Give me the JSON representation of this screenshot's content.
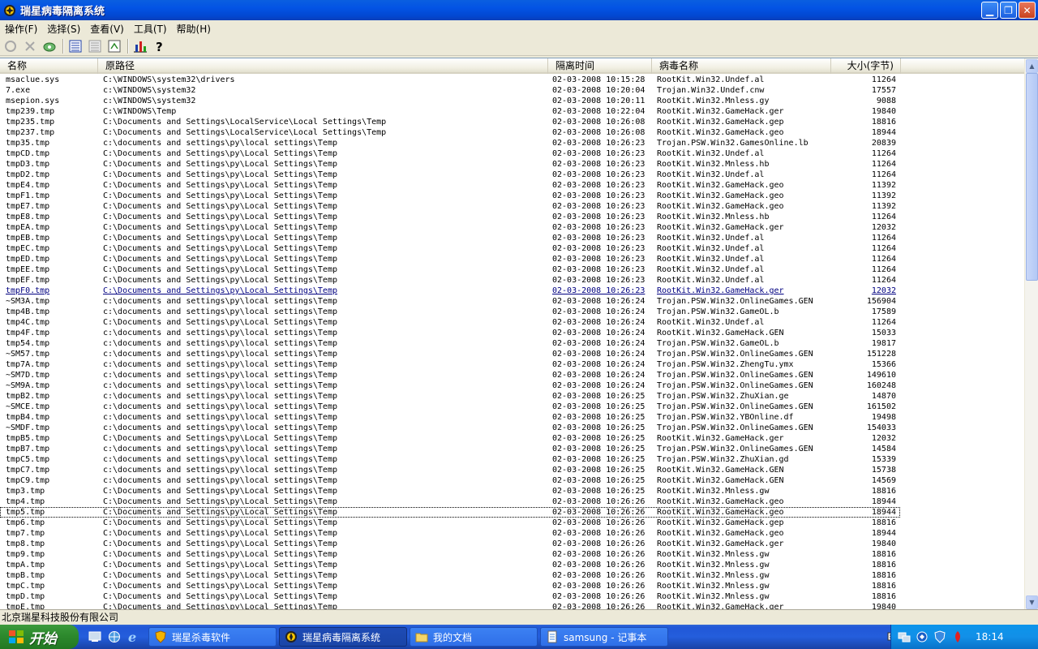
{
  "window": {
    "title": "瑞星病毒隔离系统"
  },
  "menu": [
    {
      "label": "操作(F)"
    },
    {
      "label": "选择(S)"
    },
    {
      "label": "查看(V)"
    },
    {
      "label": "工具(T)"
    },
    {
      "label": "帮助(H)"
    }
  ],
  "toolbar": {
    "icons": [
      "restore-icon",
      "delete-icon",
      "scan-icon",
      "details-view-icon",
      "list-view-icon",
      "refresh-icon",
      "chart-icon",
      "help-icon"
    ]
  },
  "columns": {
    "name": "名称",
    "path": "原路径",
    "time": "隔离时间",
    "virus": "病毒名称",
    "size": "大小(字节)"
  },
  "rows": [
    {
      "name": "msaclue.sys",
      "path": "C:\\WINDOWS\\system32\\drivers",
      "time": "02-03-2008 10:15:28",
      "virus": "RootKit.Win32.Undef.al",
      "size": "11264"
    },
    {
      "name": "7.exe",
      "path": "c:\\WINDOWS\\system32",
      "time": "02-03-2008 10:20:04",
      "virus": "Trojan.Win32.Undef.cnw",
      "size": "17557"
    },
    {
      "name": "msepion.sys",
      "path": "c:\\WINDOWS\\system32",
      "time": "02-03-2008 10:20:11",
      "virus": "RootKit.Win32.Mnless.gy",
      "size": "9088"
    },
    {
      "name": "tmp239.tmp",
      "path": "C:\\WINDOWS\\Temp",
      "time": "02-03-2008 10:22:04",
      "virus": "RootKit.Win32.GameHack.ger",
      "size": "19840"
    },
    {
      "name": "tmp235.tmp",
      "path": "C:\\Documents and Settings\\LocalService\\Local Settings\\Temp",
      "time": "02-03-2008 10:26:08",
      "virus": "RootKit.Win32.GameHack.gep",
      "size": "18816"
    },
    {
      "name": "tmp237.tmp",
      "path": "C:\\Documents and Settings\\LocalService\\Local Settings\\Temp",
      "time": "02-03-2008 10:26:08",
      "virus": "RootKit.Win32.GameHack.geo",
      "size": "18944"
    },
    {
      "name": "tmp35.tmp",
      "path": "c:\\documents and settings\\py\\local settings\\Temp",
      "time": "02-03-2008 10:26:23",
      "virus": "Trojan.PSW.Win32.GamesOnline.lb",
      "size": "20839"
    },
    {
      "name": "tmpCD.tmp",
      "path": "C:\\Documents and Settings\\py\\Local Settings\\Temp",
      "time": "02-03-2008 10:26:23",
      "virus": "RootKit.Win32.Undef.al",
      "size": "11264"
    },
    {
      "name": "tmpD3.tmp",
      "path": "C:\\Documents and Settings\\py\\Local Settings\\Temp",
      "time": "02-03-2008 10:26:23",
      "virus": "RootKit.Win32.Mnless.hb",
      "size": "11264"
    },
    {
      "name": "tmpD2.tmp",
      "path": "C:\\Documents and Settings\\py\\Local Settings\\Temp",
      "time": "02-03-2008 10:26:23",
      "virus": "RootKit.Win32.Undef.al",
      "size": "11264"
    },
    {
      "name": "tmpE4.tmp",
      "path": "C:\\Documents and Settings\\py\\Local Settings\\Temp",
      "time": "02-03-2008 10:26:23",
      "virus": "RootKit.Win32.GameHack.geo",
      "size": "11392"
    },
    {
      "name": "tmpF1.tmp",
      "path": "C:\\Documents and Settings\\py\\Local Settings\\Temp",
      "time": "02-03-2008 10:26:23",
      "virus": "RootKit.Win32.GameHack.geo",
      "size": "11392"
    },
    {
      "name": "tmpE7.tmp",
      "path": "C:\\Documents and Settings\\py\\Local Settings\\Temp",
      "time": "02-03-2008 10:26:23",
      "virus": "RootKit.Win32.GameHack.geo",
      "size": "11392"
    },
    {
      "name": "tmpE8.tmp",
      "path": "C:\\Documents and Settings\\py\\Local Settings\\Temp",
      "time": "02-03-2008 10:26:23",
      "virus": "RootKit.Win32.Mnless.hb",
      "size": "11264"
    },
    {
      "name": "tmpEA.tmp",
      "path": "C:\\Documents and Settings\\py\\Local Settings\\Temp",
      "time": "02-03-2008 10:26:23",
      "virus": "RootKit.Win32.GameHack.ger",
      "size": "12032"
    },
    {
      "name": "tmpEB.tmp",
      "path": "C:\\Documents and Settings\\py\\Local Settings\\Temp",
      "time": "02-03-2008 10:26:23",
      "virus": "RootKit.Win32.Undef.al",
      "size": "11264"
    },
    {
      "name": "tmpEC.tmp",
      "path": "C:\\Documents and Settings\\py\\Local Settings\\Temp",
      "time": "02-03-2008 10:26:23",
      "virus": "RootKit.Win32.Undef.al",
      "size": "11264"
    },
    {
      "name": "tmpED.tmp",
      "path": "C:\\Documents and Settings\\py\\Local Settings\\Temp",
      "time": "02-03-2008 10:26:23",
      "virus": "RootKit.Win32.Undef.al",
      "size": "11264"
    },
    {
      "name": "tmpEE.tmp",
      "path": "C:\\Documents and Settings\\py\\Local Settings\\Temp",
      "time": "02-03-2008 10:26:23",
      "virus": "RootKit.Win32.Undef.al",
      "size": "11264"
    },
    {
      "name": "tmpEF.tmp",
      "path": "C:\\Documents and Settings\\py\\Local Settings\\Temp",
      "time": "02-03-2008 10:26:23",
      "virus": "RootKit.Win32.Undef.al",
      "size": "11264"
    },
    {
      "name": "tmpF0.tmp",
      "path": "C:\\Documents and Settings\\py\\Local Settings\\Temp",
      "time": "02-03-2008 10:26:23",
      "virus": "RootKit.Win32.GameHack.ger",
      "size": "12032"
    },
    {
      "name": "~SM3A.tmp",
      "path": "c:\\documents and settings\\py\\local settings\\Temp",
      "time": "02-03-2008 10:26:24",
      "virus": "Trojan.PSW.Win32.OnlineGames.GEN",
      "size": "156904"
    },
    {
      "name": "tmp4B.tmp",
      "path": "c:\\documents and settings\\py\\local settings\\Temp",
      "time": "02-03-2008 10:26:24",
      "virus": "Trojan.PSW.Win32.GameOL.b",
      "size": "17589"
    },
    {
      "name": "tmp4C.tmp",
      "path": "C:\\Documents and Settings\\py\\Local Settings\\Temp",
      "time": "02-03-2008 10:26:24",
      "virus": "RootKit.Win32.Undef.al",
      "size": "11264"
    },
    {
      "name": "tmp4F.tmp",
      "path": "c:\\documents and settings\\py\\local settings\\Temp",
      "time": "02-03-2008 10:26:24",
      "virus": "RootKit.Win32.GameHack.GEN",
      "size": "15033"
    },
    {
      "name": "tmp54.tmp",
      "path": "c:\\documents and settings\\py\\local settings\\Temp",
      "time": "02-03-2008 10:26:24",
      "virus": "Trojan.PSW.Win32.GameOL.b",
      "size": "19817"
    },
    {
      "name": "~SM57.tmp",
      "path": "c:\\documents and settings\\py\\local settings\\Temp",
      "time": "02-03-2008 10:26:24",
      "virus": "Trojan.PSW.Win32.OnlineGames.GEN",
      "size": "151228"
    },
    {
      "name": "tmp7A.tmp",
      "path": "c:\\documents and settings\\py\\local settings\\Temp",
      "time": "02-03-2008 10:26:24",
      "virus": "Trojan.PSW.Win32.ZhengTu.ymx",
      "size": "15366"
    },
    {
      "name": "~SM7D.tmp",
      "path": "c:\\documents and settings\\py\\local settings\\Temp",
      "time": "02-03-2008 10:26:24",
      "virus": "Trojan.PSW.Win32.OnlineGames.GEN",
      "size": "149610"
    },
    {
      "name": "~SM9A.tmp",
      "path": "c:\\documents and settings\\py\\local settings\\Temp",
      "time": "02-03-2008 10:26:24",
      "virus": "Trojan.PSW.Win32.OnlineGames.GEN",
      "size": "160248"
    },
    {
      "name": "tmpB2.tmp",
      "path": "c:\\documents and settings\\py\\local settings\\Temp",
      "time": "02-03-2008 10:26:25",
      "virus": "Trojan.PSW.Win32.ZhuXian.ge",
      "size": "14870"
    },
    {
      "name": "~SMCE.tmp",
      "path": "c:\\documents and settings\\py\\local settings\\Temp",
      "time": "02-03-2008 10:26:25",
      "virus": "Trojan.PSW.Win32.OnlineGames.GEN",
      "size": "161502"
    },
    {
      "name": "tmpB4.tmp",
      "path": "c:\\documents and settings\\py\\local settings\\Temp",
      "time": "02-03-2008 10:26:25",
      "virus": "Trojan.PSW.Win32.YBOnline.df",
      "size": "19498"
    },
    {
      "name": "~SMDF.tmp",
      "path": "c:\\documents and settings\\py\\local settings\\Temp",
      "time": "02-03-2008 10:26:25",
      "virus": "Trojan.PSW.Win32.OnlineGames.GEN",
      "size": "154033"
    },
    {
      "name": "tmpB5.tmp",
      "path": "C:\\Documents and Settings\\py\\Local Settings\\Temp",
      "time": "02-03-2008 10:26:25",
      "virus": "RootKit.Win32.GameHack.ger",
      "size": "12032"
    },
    {
      "name": "tmpB7.tmp",
      "path": "c:\\documents and settings\\py\\local settings\\Temp",
      "time": "02-03-2008 10:26:25",
      "virus": "Trojan.PSW.Win32.OnlineGames.GEN",
      "size": "14584"
    },
    {
      "name": "tmpC5.tmp",
      "path": "c:\\documents and settings\\py\\local settings\\Temp",
      "time": "02-03-2008 10:26:25",
      "virus": "Trojan.PSW.Win32.ZhuXian.gd",
      "size": "15339"
    },
    {
      "name": "tmpC7.tmp",
      "path": "c:\\documents and settings\\py\\local settings\\Temp",
      "time": "02-03-2008 10:26:25",
      "virus": "RootKit.Win32.GameHack.GEN",
      "size": "15738"
    },
    {
      "name": "tmpC9.tmp",
      "path": "c:\\documents and settings\\py\\local settings\\Temp",
      "time": "02-03-2008 10:26:25",
      "virus": "RootKit.Win32.GameHack.GEN",
      "size": "14569"
    },
    {
      "name": "tmp3.tmp",
      "path": "C:\\Documents and Settings\\py\\Local Settings\\Temp",
      "time": "02-03-2008 10:26:25",
      "virus": "RootKit.Win32.Mnless.gw",
      "size": "18816"
    },
    {
      "name": "tmp4.tmp",
      "path": "C:\\Documents and Settings\\py\\Local Settings\\Temp",
      "time": "02-03-2008 10:26:26",
      "virus": "RootKit.Win32.GameHack.geo",
      "size": "18944"
    },
    {
      "name": "tmp5.tmp",
      "path": "C:\\Documents and Settings\\py\\Local Settings\\Temp",
      "time": "02-03-2008 10:26:26",
      "virus": "RootKit.Win32.GameHack.geo",
      "size": "18944"
    },
    {
      "name": "tmp6.tmp",
      "path": "C:\\Documents and Settings\\py\\Local Settings\\Temp",
      "time": "02-03-2008 10:26:26",
      "virus": "RootKit.Win32.GameHack.gep",
      "size": "18816"
    },
    {
      "name": "tmp7.tmp",
      "path": "C:\\Documents and Settings\\py\\Local Settings\\Temp",
      "time": "02-03-2008 10:26:26",
      "virus": "RootKit.Win32.GameHack.geo",
      "size": "18944"
    },
    {
      "name": "tmp8.tmp",
      "path": "C:\\Documents and Settings\\py\\Local Settings\\Temp",
      "time": "02-03-2008 10:26:26",
      "virus": "RootKit.Win32.GameHack.ger",
      "size": "19840"
    },
    {
      "name": "tmp9.tmp",
      "path": "C:\\Documents and Settings\\py\\Local Settings\\Temp",
      "time": "02-03-2008 10:26:26",
      "virus": "RootKit.Win32.Mnless.gw",
      "size": "18816"
    },
    {
      "name": "tmpA.tmp",
      "path": "C:\\Documents and Settings\\py\\Local Settings\\Temp",
      "time": "02-03-2008 10:26:26",
      "virus": "RootKit.Win32.Mnless.gw",
      "size": "18816"
    },
    {
      "name": "tmpB.tmp",
      "path": "C:\\Documents and Settings\\py\\Local Settings\\Temp",
      "time": "02-03-2008 10:26:26",
      "virus": "RootKit.Win32.Mnless.gw",
      "size": "18816"
    },
    {
      "name": "tmpC.tmp",
      "path": "C:\\Documents and Settings\\py\\Local Settings\\Temp",
      "time": "02-03-2008 10:26:26",
      "virus": "RootKit.Win32.Mnless.gw",
      "size": "18816"
    },
    {
      "name": "tmpD.tmp",
      "path": "C:\\Documents and Settings\\py\\Local Settings\\Temp",
      "time": "02-03-2008 10:26:26",
      "virus": "RootKit.Win32.Mnless.gw",
      "size": "18816"
    },
    {
      "name": "tmpE.tmp",
      "path": "C:\\Documents and Settings\\py\\Local Settings\\Temp",
      "time": "02-03-2008 10:26:26",
      "virus": "RootKit.Win32.GameHack.ger",
      "size": "19840"
    }
  ],
  "hot_row": 20,
  "focus_row": 41,
  "status": {
    "text": "北京瑞星科技股份有限公司"
  },
  "taskbar": {
    "start_label": "开始",
    "tasks": [
      {
        "label": "瑞星杀毒软件",
        "icon": "shield-icon",
        "active": false
      },
      {
        "label": "瑞星病毒隔离系统",
        "icon": "quarantine-icon",
        "active": true
      },
      {
        "label": "我的文档",
        "icon": "folder-icon",
        "active": false
      },
      {
        "label": "samsung - 记事本",
        "icon": "notepad-icon",
        "active": false
      }
    ],
    "clock": "18:14"
  }
}
